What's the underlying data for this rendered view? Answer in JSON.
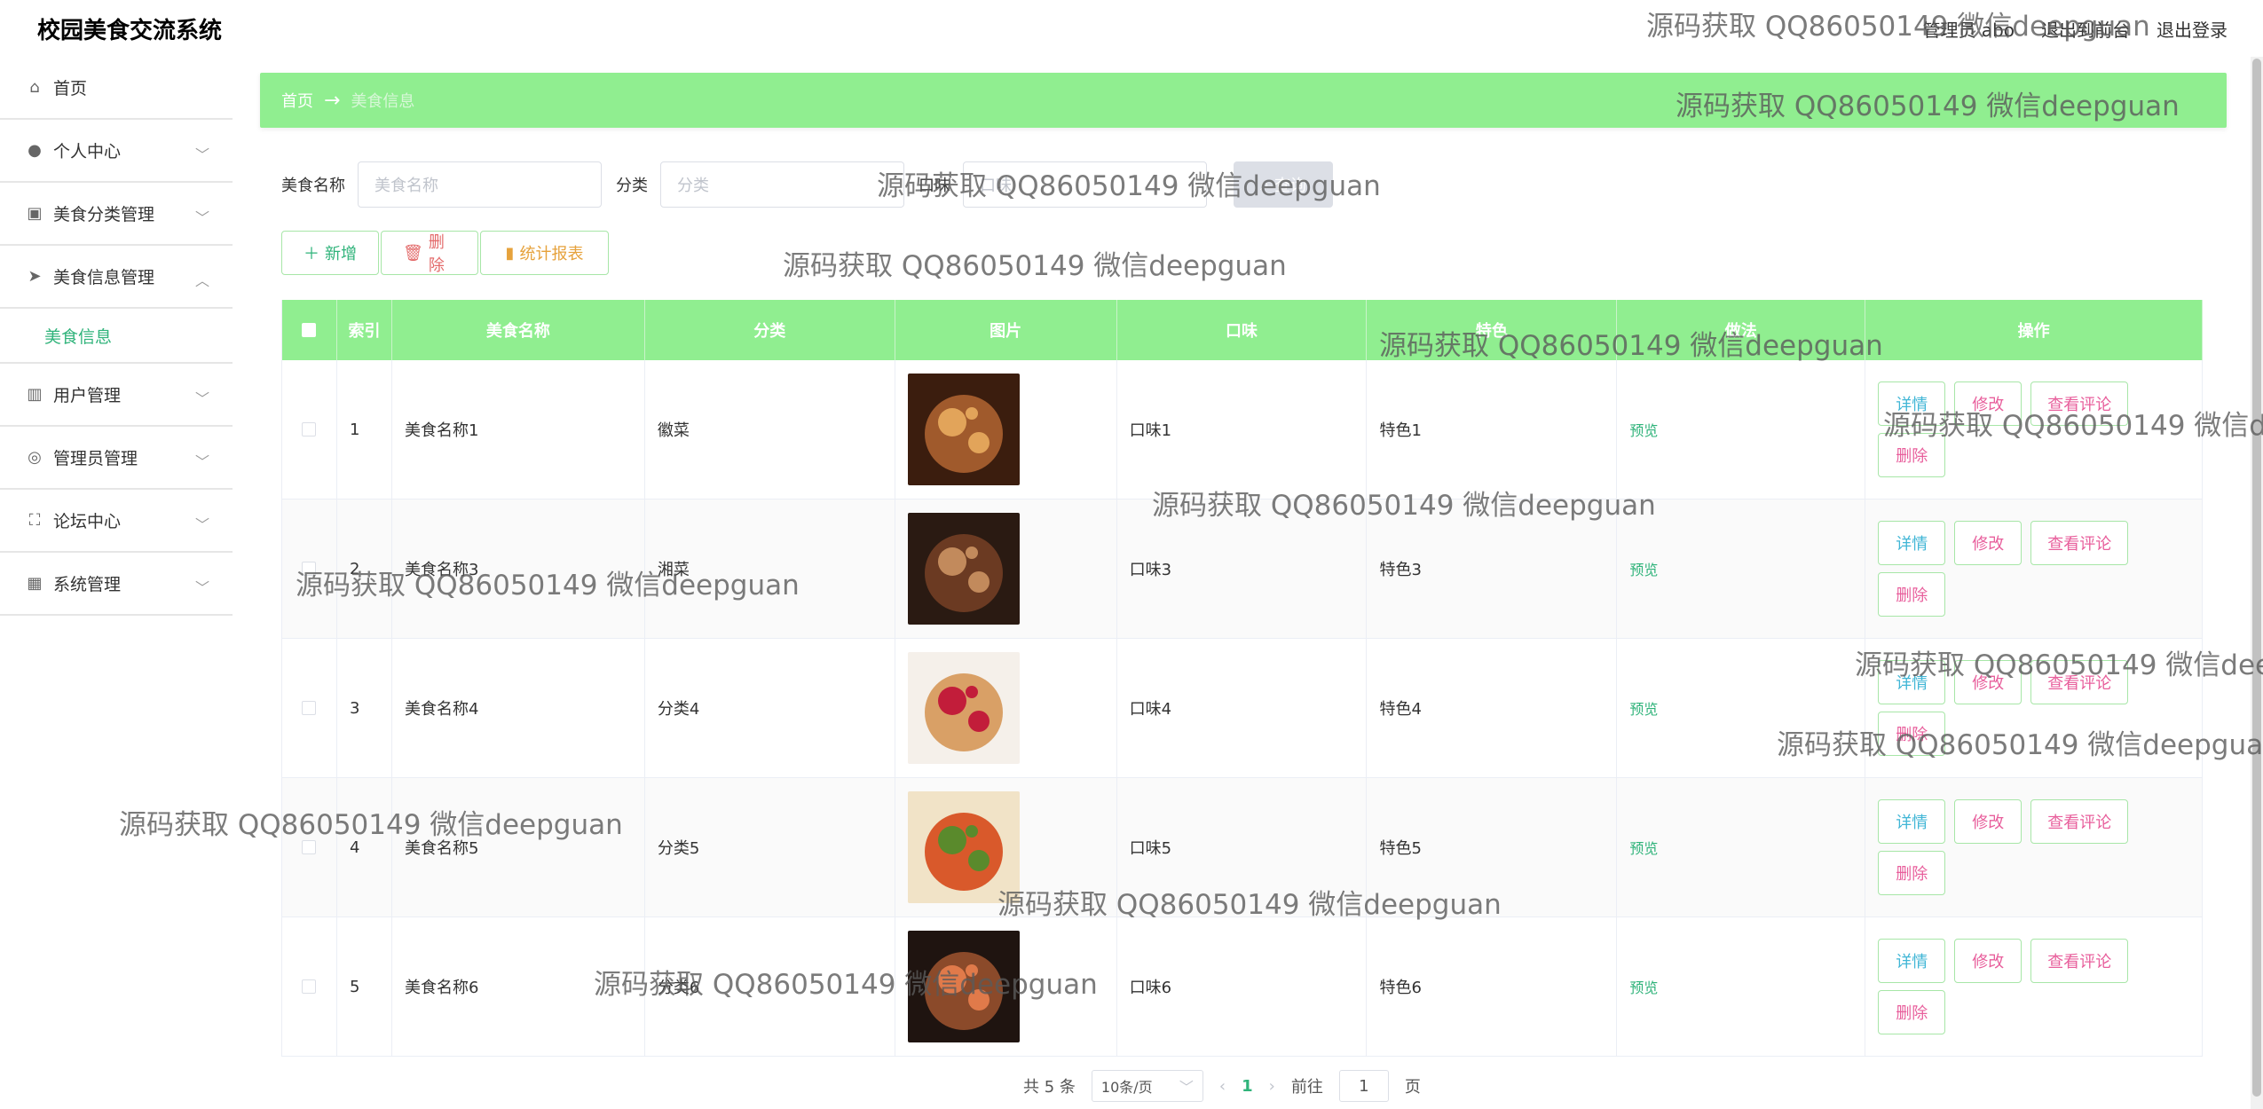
{
  "app": {
    "title": "校园美食交流系统"
  },
  "topbar": {
    "user": "管理员 abo",
    "back_front": "退出到前台",
    "logout": "退出登录"
  },
  "sidebar": {
    "items": [
      {
        "label": "首页",
        "icon": "home-icon"
      },
      {
        "label": "个人中心",
        "icon": "user-icon"
      },
      {
        "label": "美食分类管理",
        "icon": "category-icon"
      },
      {
        "label": "美食信息管理",
        "icon": "send-icon"
      },
      {
        "label": "用户管理",
        "icon": "chart-icon"
      },
      {
        "label": "管理员管理",
        "icon": "compass-icon"
      },
      {
        "label": "论坛中心",
        "icon": "fullscreen-icon"
      },
      {
        "label": "系统管理",
        "icon": "grid-icon"
      }
    ],
    "subitem": "美食信息"
  },
  "breadcrumb": {
    "home": "首页",
    "current": "美食信息"
  },
  "search": {
    "name_label": "美食名称",
    "name_placeholder": "美食名称",
    "cat_label": "分类",
    "cat_placeholder": "分类",
    "taste_label": "口味",
    "taste_placeholder": "口味",
    "button": "查询"
  },
  "actions": {
    "add": "新增",
    "delete": "删除",
    "stats": "统计报表"
  },
  "table": {
    "headers": [
      "索引",
      "美食名称",
      "分类",
      "图片",
      "口味",
      "特色",
      "做法",
      "操作"
    ],
    "rows": [
      {
        "idx": "1",
        "name": "美食名称1",
        "cat": "徽菜",
        "taste": "口味1",
        "feat": "特色1",
        "cook": "预览"
      },
      {
        "idx": "2",
        "name": "美食名称3",
        "cat": "湘菜",
        "taste": "口味3",
        "feat": "特色3",
        "cook": "预览"
      },
      {
        "idx": "3",
        "name": "美食名称4",
        "cat": "分类4",
        "taste": "口味4",
        "feat": "特色4",
        "cook": "预览"
      },
      {
        "idx": "4",
        "name": "美食名称5",
        "cat": "分类5",
        "taste": "口味5",
        "feat": "特色5",
        "cook": "预览"
      },
      {
        "idx": "5",
        "name": "美食名称6",
        "cat": "分类6",
        "taste": "口味6",
        "feat": "特色6",
        "cook": "预览"
      }
    ],
    "ops": {
      "detail": "详情",
      "edit": "修改",
      "review": "查看评论",
      "remove": "删除"
    }
  },
  "pager": {
    "total": "共 5 条",
    "size": "10条/页",
    "current": "1",
    "goto": "前往",
    "goto_value": "1",
    "page_unit": "页"
  },
  "watermark": "源码获取 QQ86050149 微信deepguan",
  "colors": {
    "accent": "#90ee90",
    "link": "#2fb37a",
    "danger": "#e36b6b",
    "warning": "#e6a23c"
  }
}
